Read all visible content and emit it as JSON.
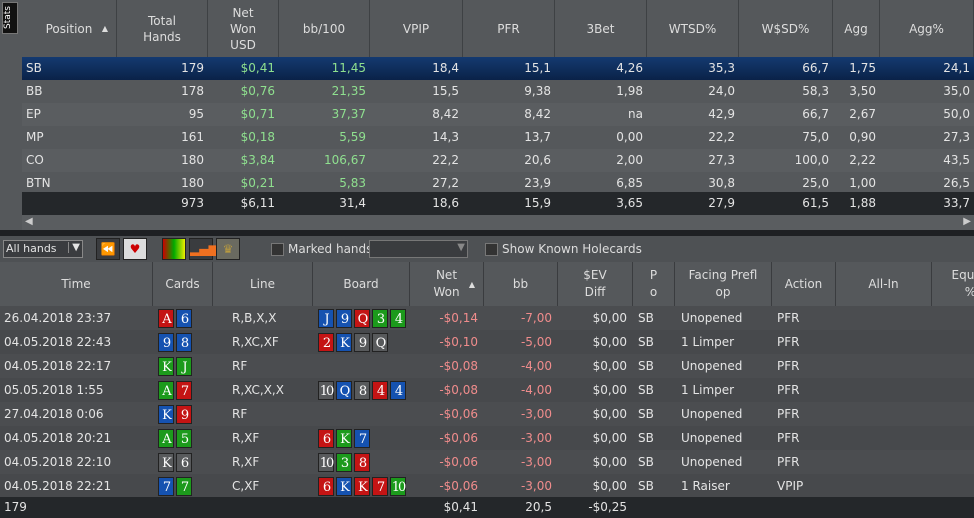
{
  "stats_tab": "Stats",
  "stats": {
    "columns": [
      "Position",
      "Total Hands",
      "Net Won USD",
      "bb/100",
      "VPIP",
      "PFR",
      "3Bet",
      "WTSD%",
      "W$SD%",
      "Agg",
      "Agg%"
    ],
    "rows": [
      [
        "SB",
        "179",
        "$0,41",
        "11,45",
        "18,4",
        "15,1",
        "4,26",
        "35,3",
        "66,7",
        "1,75",
        "24,1"
      ],
      [
        "BB",
        "178",
        "$0,76",
        "21,35",
        "15,5",
        "9,38",
        "1,98",
        "24,0",
        "58,3",
        "3,50",
        "35,0"
      ],
      [
        "EP",
        "95",
        "$0,71",
        "37,37",
        "8,42",
        "8,42",
        "na",
        "42,9",
        "66,7",
        "2,67",
        "50,0"
      ],
      [
        "MP",
        "161",
        "$0,18",
        "5,59",
        "14,3",
        "13,7",
        "0,00",
        "22,2",
        "75,0",
        "0,90",
        "27,3"
      ],
      [
        "CO",
        "180",
        "$3,84",
        "106,67",
        "22,2",
        "20,6",
        "2,00",
        "27,3",
        "100,0",
        "2,22",
        "43,5"
      ],
      [
        "BTN",
        "180",
        "$0,21",
        "5,83",
        "27,2",
        "23,9",
        "6,85",
        "30,8",
        "25,0",
        "1,00",
        "26,5"
      ]
    ],
    "selected_row": 0,
    "totals": [
      "",
      "973",
      "$6,11",
      "31,4",
      "18,6",
      "15,9",
      "3,65",
      "27,9",
      "61,5",
      "1,88",
      "33,7"
    ]
  },
  "toolbar": {
    "filter": "All hands",
    "marked_hands": "Marked hands",
    "marked_value": "",
    "show_known": "Show Known Holecards"
  },
  "hands": {
    "columns": [
      "Time",
      "Cards",
      "Line",
      "Board",
      "Net Won",
      "bb",
      "$EV Diff",
      "Po",
      "Facing Preflop",
      "Action",
      "All-In",
      "Equity %"
    ],
    "rows": [
      {
        "time": "26.04.2018 23:37",
        "cards": [
          "Ah",
          "6d"
        ],
        "line": "R,B,X,X",
        "board": [
          "Jd",
          "9d",
          "Qh",
          "3c",
          "4c"
        ],
        "net": "-$0,14",
        "bb": "-7,00",
        "ev": "$0,00",
        "pos": "SB",
        "facing": "Unopened",
        "action": "PFR"
      },
      {
        "time": "04.05.2018 22:43",
        "cards": [
          "9d",
          "8d"
        ],
        "line": "R,XC,XF",
        "board": [
          "2h",
          "Kd",
          "9s",
          "Qs"
        ],
        "net": "-$0,10",
        "bb": "-5,00",
        "ev": "$0,00",
        "pos": "SB",
        "facing": "1 Limper",
        "action": "PFR"
      },
      {
        "time": "04.05.2018 22:17",
        "cards": [
          "Kc",
          "Jc"
        ],
        "line": "RF",
        "board": [],
        "net": "-$0,08",
        "bb": "-4,00",
        "ev": "$0,00",
        "pos": "SB",
        "facing": "Unopened",
        "action": "PFR"
      },
      {
        "time": "05.05.2018 1:55",
        "cards": [
          "Ac",
          "7h"
        ],
        "line": "R,XC,X,X",
        "board": [
          "10s",
          "Qd",
          "8s",
          "4h",
          "4d"
        ],
        "net": "-$0,08",
        "bb": "-4,00",
        "ev": "$0,00",
        "pos": "SB",
        "facing": "1 Limper",
        "action": "PFR"
      },
      {
        "time": "27.04.2018 0:06",
        "cards": [
          "Kd",
          "9h"
        ],
        "line": "RF",
        "board": [],
        "net": "-$0,06",
        "bb": "-3,00",
        "ev": "$0,00",
        "pos": "SB",
        "facing": "Unopened",
        "action": "PFR"
      },
      {
        "time": "04.05.2018 20:21",
        "cards": [
          "Ac",
          "5c"
        ],
        "line": "R,XF",
        "board": [
          "6h",
          "Kc",
          "7d"
        ],
        "net": "-$0,06",
        "bb": "-3,00",
        "ev": "$0,00",
        "pos": "SB",
        "facing": "Unopened",
        "action": "PFR"
      },
      {
        "time": "04.05.2018 22:10",
        "cards": [
          "Ks",
          "6s"
        ],
        "line": "R,XF",
        "board": [
          "10s",
          "3c",
          "8h"
        ],
        "net": "-$0,06",
        "bb": "-3,00",
        "ev": "$0,00",
        "pos": "SB",
        "facing": "Unopened",
        "action": "PFR"
      },
      {
        "time": "04.05.2018 22:21",
        "cards": [
          "7d",
          "7c"
        ],
        "line": "C,XF",
        "board": [
          "6h",
          "Kd",
          "Kh",
          "7h",
          "10c"
        ],
        "net": "-$0,06",
        "bb": "-3,00",
        "ev": "$0,00",
        "pos": "SB",
        "facing": "1 Raiser",
        "action": "VPIP"
      }
    ],
    "totals": {
      "count": "179",
      "net": "$0,41",
      "bb": "20,5",
      "ev": "-$0,25"
    }
  },
  "colors": {
    "hearts": "#c41414",
    "diamonds": "#1552b0",
    "clubs": "#1c9a1c",
    "spades": "#585a5c",
    "selected": "#0c2d5e",
    "positive": "#8fe08f",
    "negative": "#f08c8c"
  }
}
